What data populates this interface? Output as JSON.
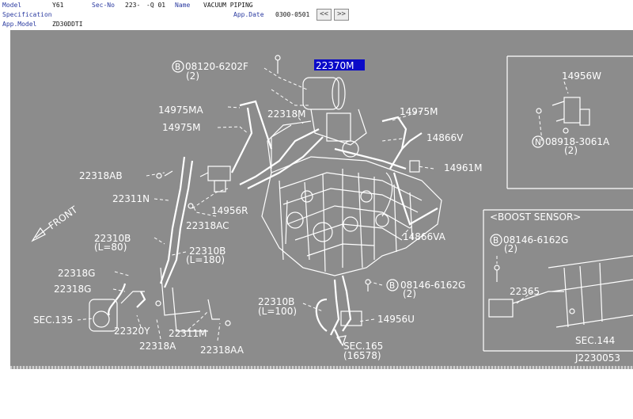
{
  "header": {
    "model_label": "Model",
    "model_value": "Y61",
    "secno_label": "Sec-No",
    "secno_value": "223-",
    "q_value": "-Q 01",
    "name_label": "Name",
    "name_value": "VACUUM PIPING",
    "spec_label": "Specification",
    "appdate_label": "App.Date",
    "appdate_value": "0300-0501",
    "appmodel_label": "App.Model",
    "appmodel_value": "ZD30DDTI",
    "prev_glyph": "<<",
    "next_glyph": ">>"
  },
  "colors": {
    "diagram_bg": "#8c8c8c",
    "line": "#ffffff",
    "highlight": "#0a0ac8"
  },
  "diagram": {
    "labels": {
      "bolt_top_num": "08120-6202F",
      "bolt_top_qty": "(2)",
      "part_22370m": "22370M",
      "part_14975ma": "14975MA",
      "part_22318m": "22318M",
      "part_14975m_r": "14975M",
      "part_14975m_l": "14975M",
      "part_14866v": "14866V",
      "part_22318ab": "22318AB",
      "part_14961m": "14961M",
      "part_22311n": "22311N",
      "part_14956r": "14956R",
      "part_22318ac": "22318AC",
      "front": "FRONT",
      "part_22310b_top": "22310B",
      "part_22310b_top_len": "(L=80)",
      "part_22310b_mid": "22310B",
      "part_22310b_mid_len": "(L=180)",
      "part_14866va": "14866VA",
      "part_22318g_a": "22318G",
      "part_22318g_b": "22318G",
      "bolt_mid_num": "08146-6162G",
      "bolt_mid_qty": "(2)",
      "part_22310b_low": "22310B",
      "part_22310b_low_len": "(L=100)",
      "sec135": "SEC.135",
      "part_22320y": "22320Y",
      "part_22311m": "22311M",
      "part_14956u": "14956U",
      "part_22318a": "22318A",
      "part_22318aa": "22318AA",
      "sec165": "SEC.165",
      "sec165_sub": "(16578)",
      "part_14956w": "14956W",
      "nut_num": "08918-3061A",
      "nut_qty": "(2)",
      "boost_title": "<BOOST SENSOR>",
      "boost_bolt_num": "08146-6162G",
      "boost_bolt_qty": "(2)",
      "part_22365": "22365",
      "sec144": "SEC.144",
      "figure_id": "J2230053",
      "circle_b": "B",
      "circle_n": "N"
    }
  }
}
